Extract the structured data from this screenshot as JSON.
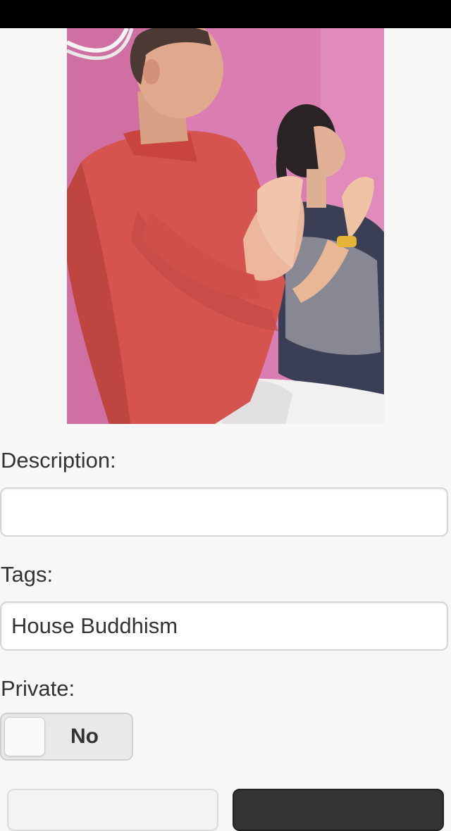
{
  "form": {
    "description_label": "Description:",
    "description_value": "",
    "tags_label": "Tags:",
    "tags_value": "House Buddhism",
    "private_label": "Private:",
    "private_toggle_text": "No",
    "private_enabled": false
  },
  "colors": {
    "background": "#f7f7f7",
    "status_bar": "#000000",
    "wall": "#dc82b6",
    "shirt": "#d8524e",
    "dark_button": "#333333"
  }
}
